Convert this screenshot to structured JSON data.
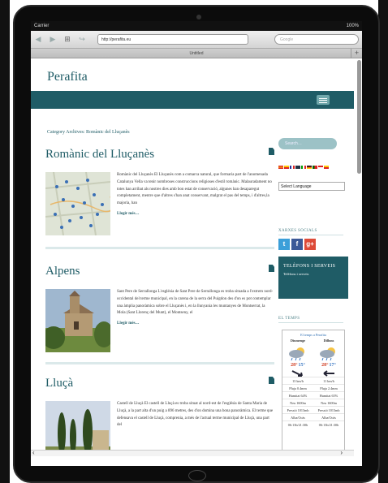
{
  "status": {
    "carrier": "Carrier",
    "battery": "100%"
  },
  "browser": {
    "url": "http://perafita.eu",
    "search_placeholder": "Google",
    "tab_title": "Untitled",
    "new_tab": "+"
  },
  "site": {
    "title": "Perafita"
  },
  "category_heading": "Category Archives: Romànic del Lluçanès",
  "posts": [
    {
      "title": "Romànic del Lluçanès",
      "excerpt": "Romànic del Lluçanès El Lluçanès com a comarca natural, que formaria part de l'anomenada Catalunya Vella va tenir nombroses construccions religioses d'estil romànic. Malauradament no totes han arribat als nostres dies amb bon estat de conservació, algunes han desaparegut completament, mentre que d'altres s'han anat conservant, malgrat el pas del temps, i d'altres,la majoria, han",
      "more": "Llegir més…"
    },
    {
      "title": "Alpens",
      "excerpt": "Sant Pere de Serrallonga L'església de Sant Pere de Serrallonga es troba situada a l'extrem nord-occidental del terme municipal, en la carena de la serra del Puigdon des d'on es pot contemplar una àmplia panoràmica sobre el Lluçanès i, en la llunyania les muntanyes de Montserrat, la Mola (Sant Llorenç del Munt), el Montseny, el",
      "more": "Llegir més…"
    },
    {
      "title": "Lluçà",
      "excerpt": "Castell de Lluçà El castell de Lluçà es troba situat al nord-est de l'església de Santa Maria de Lluçà, a la part alta d'un puig a 896 metres, des d'on domina una bona panoràmica. El terme que defensava el castell de Lluçà, comprenia, a més de l'actual terme municipal de Lluçà, una part del",
      "more": ""
    }
  ],
  "sidebar": {
    "search_placeholder": "Search…",
    "language_select": "Select Language",
    "social_heading": "XARXES SOCIALS",
    "social": [
      {
        "name": "twitter",
        "glyph": "t",
        "color": "#3b9fd9"
      },
      {
        "name": "facebook",
        "glyph": "f",
        "color": "#3b5998"
      },
      {
        "name": "google-plus",
        "glyph": "g+",
        "color": "#dd4b39"
      }
    ],
    "phones_title": "TELÈFONS I SERVEIS",
    "phones_link": "Telèfons i serveis",
    "weather_heading": "EL TEMPS"
  },
  "weather": {
    "header": "El temps a Perafita",
    "days": [
      {
        "day": "Diumenge",
        "hi": "28°",
        "lo": "15°",
        "wind": "13 km/h",
        "rain": "Pluja 0.4mm",
        "humidity": "Humitat 64%",
        "snow": "Neu 1600m",
        "pressure": "Pressió 1013mb",
        "sun": "Alba/Ocàs",
        "times": "06:13h/21:30h"
      },
      {
        "day": "Dilluns",
        "hi": "28°",
        "lo": "17°",
        "wind": "11 km/h",
        "rain": "Pluja 2.4mm",
        "humidity": "Humitat 65%",
        "snow": "Neu 1600m",
        "pressure": "Pressió 1013mb",
        "sun": "Alba/Ocàs",
        "times": "06:13h/21:30h"
      }
    ]
  },
  "colors": {
    "brand": "#1f5c66",
    "nav": "#1f5c66",
    "light_teal": "#9cc2c6",
    "link": "#1f5c66"
  }
}
